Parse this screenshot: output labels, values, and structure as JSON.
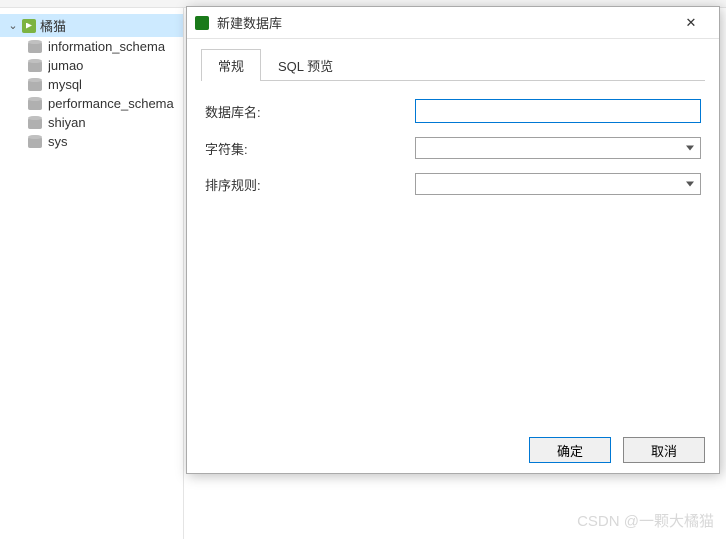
{
  "sidebar": {
    "connection_name": "橘猫",
    "databases": [
      "information_schema",
      "jumao",
      "mysql",
      "performance_schema",
      "shiyan",
      "sys"
    ]
  },
  "dialog": {
    "title": "新建数据库",
    "tabs": {
      "general": "常规",
      "sql_preview": "SQL 预览"
    },
    "fields": {
      "db_name_label": "数据库名:",
      "charset_label": "字符集:",
      "collation_label": "排序规则:",
      "db_name_value": "",
      "charset_value": "",
      "collation_value": ""
    },
    "buttons": {
      "ok": "确定",
      "cancel": "取消"
    }
  },
  "watermark": "CSDN @一颗大橘猫"
}
